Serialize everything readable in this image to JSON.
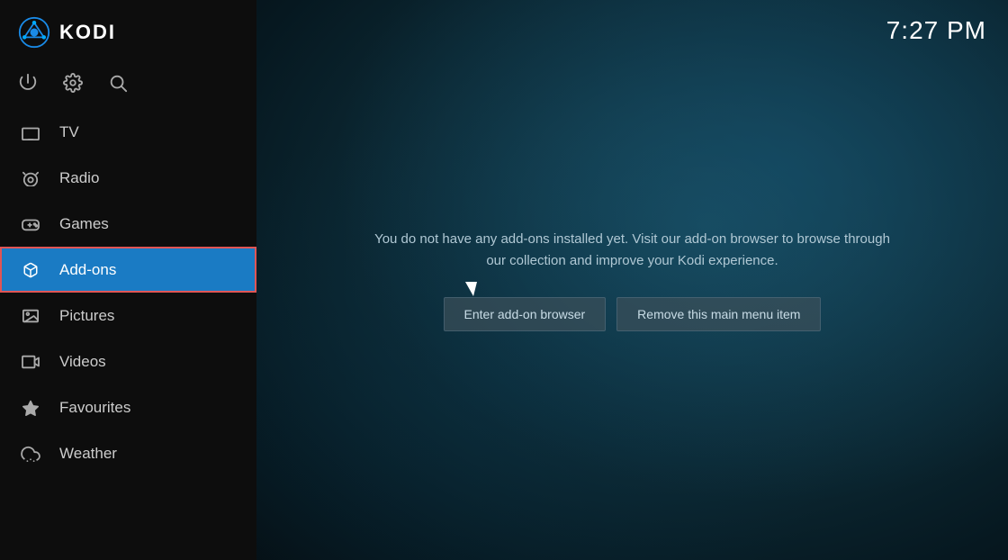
{
  "app": {
    "title": "KODI",
    "time": "7:27 PM"
  },
  "sidebar": {
    "icons": [
      {
        "name": "power-icon",
        "symbol": "⏻"
      },
      {
        "name": "settings-icon",
        "symbol": "⚙"
      },
      {
        "name": "search-icon",
        "symbol": "🔍"
      }
    ],
    "nav_items": [
      {
        "id": "tv",
        "label": "TV",
        "icon": "tv-icon",
        "active": false
      },
      {
        "id": "radio",
        "label": "Radio",
        "icon": "radio-icon",
        "active": false
      },
      {
        "id": "games",
        "label": "Games",
        "icon": "games-icon",
        "active": false
      },
      {
        "id": "addons",
        "label": "Add-ons",
        "icon": "addons-icon",
        "active": true
      },
      {
        "id": "pictures",
        "label": "Pictures",
        "icon": "pictures-icon",
        "active": false
      },
      {
        "id": "videos",
        "label": "Videos",
        "icon": "videos-icon",
        "active": false
      },
      {
        "id": "favourites",
        "label": "Favourites",
        "icon": "favourites-icon",
        "active": false
      },
      {
        "id": "weather",
        "label": "Weather",
        "icon": "weather-icon",
        "active": false
      }
    ]
  },
  "main": {
    "info_text": "You do not have any add-ons installed yet. Visit our add-on browser to browse through our collection and improve your Kodi experience.",
    "buttons": [
      {
        "id": "enter-addon-browser",
        "label": "Enter add-on browser"
      },
      {
        "id": "remove-menu-item",
        "label": "Remove this main menu item"
      }
    ]
  }
}
